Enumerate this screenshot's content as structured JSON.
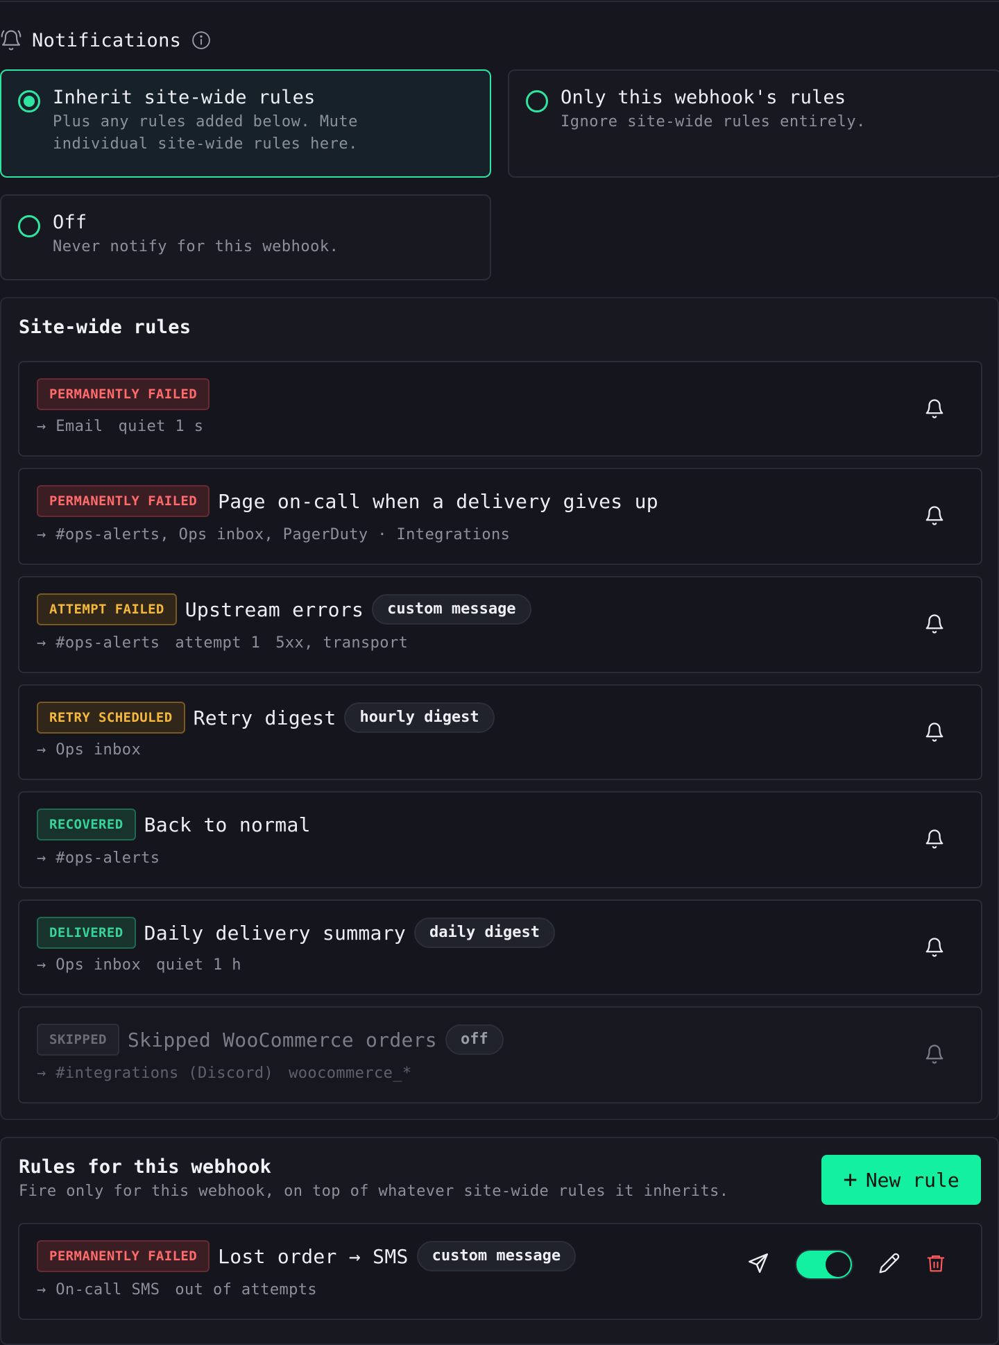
{
  "header": {
    "title": "Notifications"
  },
  "modes": [
    {
      "title": "Inherit site-wide rules",
      "desc_line1": "Plus any rules added below. Mute",
      "desc_line2": "individual site-wide rules here.",
      "selected": true
    },
    {
      "title": "Only this webhook's rules",
      "desc_line1": "Ignore site-wide rules entirely.",
      "selected": false
    },
    {
      "title": "Off",
      "desc_line1": "Never notify for this webhook.",
      "selected": false
    }
  ],
  "site_wide": {
    "title": "Site-wide rules",
    "rules": [
      {
        "badge": "PERMANENTLY FAILED",
        "name": "",
        "pill": "",
        "targets": [
          "→ Email",
          "quiet 1 s"
        ]
      },
      {
        "badge": "PERMANENTLY FAILED",
        "name": "Page on-call when a delivery gives up",
        "pill": "",
        "targets": [
          "→ #ops-alerts, Ops inbox, PagerDuty · Integrations"
        ]
      },
      {
        "badge": "ATTEMPT FAILED",
        "name": "Upstream errors",
        "pill": "custom message",
        "targets": [
          "→ #ops-alerts",
          "attempt 1",
          "5xx, transport"
        ]
      },
      {
        "badge": "RETRY SCHEDULED",
        "name": "Retry digest",
        "pill": "hourly digest",
        "targets": [
          "→ Ops inbox"
        ]
      },
      {
        "badge": "RECOVERED",
        "name": "Back to normal",
        "pill": "",
        "targets": [
          "→ #ops-alerts"
        ]
      },
      {
        "badge": "DELIVERED",
        "name": "Daily delivery summary",
        "pill": "daily digest",
        "targets": [
          "→ Ops inbox",
          "quiet 1 h"
        ]
      },
      {
        "badge": "SKIPPED",
        "name": "Skipped WooCommerce orders",
        "pill": "off",
        "targets": [
          "→ #integrations (Discord)",
          "woocommerce_*"
        ]
      }
    ]
  },
  "webhook_rules": {
    "title": "Rules for this webhook",
    "subtitle": "Fire only for this webhook, on top of whatever site-wide rules it inherits.",
    "new_rule_label": "New rule",
    "rules": [
      {
        "badge": "PERMANENTLY FAILED",
        "name": "Lost order → SMS",
        "pill": "custom message",
        "targets": [
          "→ On-call SMS",
          "out of attempts"
        ],
        "enabled": true
      }
    ]
  },
  "colors": {
    "accent": "#12f0a0",
    "danger": "#ff6b6b",
    "warning": "#f5b83a",
    "success": "#36d49a"
  },
  "icons": [
    "bell-icon",
    "info-icon",
    "send-icon",
    "pencil-icon",
    "trash-icon",
    "plus-icon"
  ]
}
